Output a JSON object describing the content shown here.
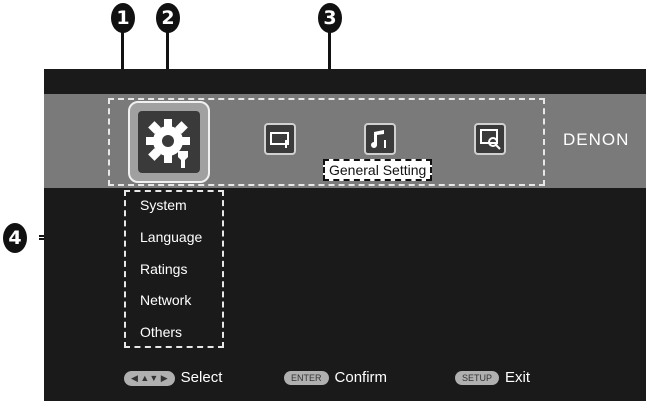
{
  "callouts": [
    "1",
    "2",
    "3",
    "4"
  ],
  "toolbar": {
    "icons": [
      "general-setting-icon",
      "display-setting-icon",
      "audio-setting-icon",
      "info-icon"
    ],
    "brand": "DENON",
    "tooltip": "General Setting"
  },
  "menu": {
    "items": [
      "System",
      "Language",
      "Ratings",
      "Network",
      "Others"
    ]
  },
  "footer": {
    "select_label": "Select",
    "enter_key": "ENTER",
    "confirm_label": "Confirm",
    "setup_key": "SETUP",
    "exit_label": "Exit"
  },
  "colors": {
    "screen_bg": "#1a1a1a",
    "toolbar_bg": "#7a7a7a",
    "dash": "#e8e8e8"
  }
}
